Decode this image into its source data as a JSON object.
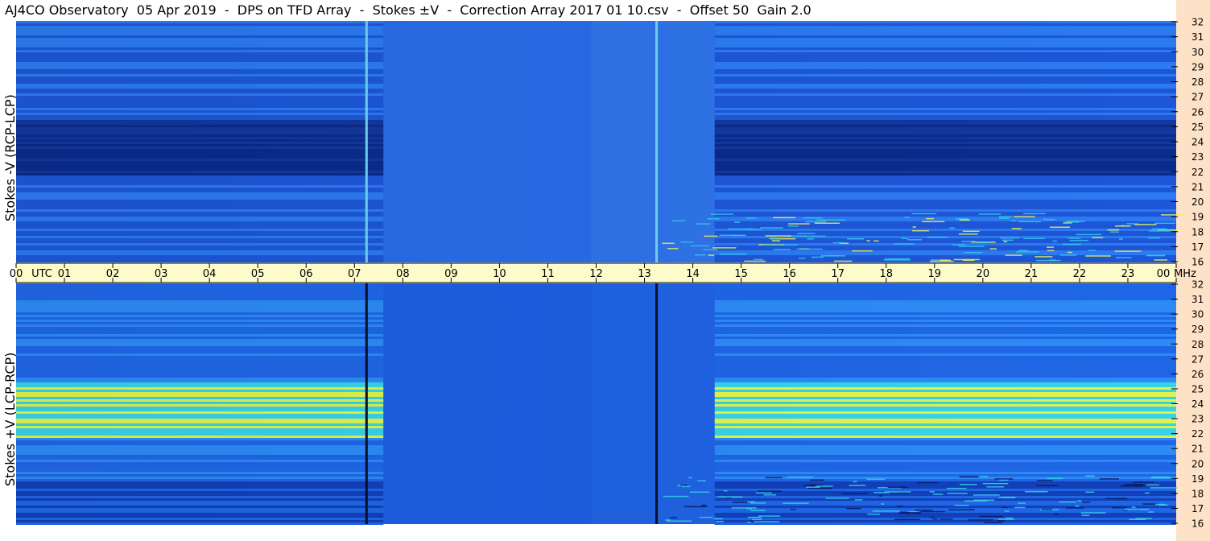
{
  "title": "AJ4CO Observatory  05 Apr 2019  -  DPS on TFD Array  -  Stokes ±V  -  Correction Array 2017 01 10.csv  -  Offset 50  Gain 2.0",
  "chart_data": [
    {
      "type": "heatmap",
      "panel": "top",
      "ylabel": "Stokes -V (RCP-LCP)",
      "y_ticks": [
        32,
        31,
        30,
        29,
        28,
        27,
        26,
        25,
        24,
        23,
        22,
        21,
        20,
        19,
        18,
        17,
        16
      ],
      "ylim": [
        16,
        32
      ],
      "y_unit": "MHz",
      "x_ticks": [
        "00",
        "01",
        "02",
        "03",
        "04",
        "05",
        "06",
        "07",
        "08",
        "09",
        "10",
        "11",
        "12",
        "13",
        "14",
        "15",
        "16",
        "17",
        "18",
        "19",
        "20",
        "21",
        "22",
        "23",
        "00"
      ],
      "x_unit": "UTC",
      "xlim_hours": [
        0,
        24
      ],
      "colors": {
        "deep": "#0a2b8a",
        "mid": "#1d56d6",
        "bright": "#2c7af0",
        "cyan": "#35c8f0",
        "yellow": "#f2f05a"
      },
      "gaps_utc_hours": [
        7.25,
        13.25
      ]
    },
    {
      "type": "heatmap",
      "panel": "bottom",
      "ylabel": "Stokes +V (LCP-RCP)",
      "y_ticks": [
        32,
        31,
        30,
        29,
        28,
        27,
        26,
        25,
        24,
        23,
        22,
        21,
        20,
        19,
        18,
        17,
        16
      ],
      "ylim": [
        16,
        32
      ],
      "y_unit": "MHz",
      "x_ticks": [
        "00",
        "01",
        "02",
        "03",
        "04",
        "05",
        "06",
        "07",
        "08",
        "09",
        "10",
        "11",
        "12",
        "13",
        "14",
        "15",
        "16",
        "17",
        "18",
        "19",
        "20",
        "21",
        "22",
        "23",
        "00"
      ],
      "x_unit": "UTC",
      "xlim_hours": [
        0,
        24
      ],
      "colors": {
        "deep": "#1240b8",
        "mid": "#1f66e6",
        "bright": "#2c8af5",
        "cyan": "#38d2e8",
        "yellow": "#dff24c"
      },
      "gaps_utc_hours": [
        7.25,
        13.25
      ]
    }
  ],
  "axis": {
    "utc_label": "UTC",
    "mhz_label": "MHz"
  }
}
